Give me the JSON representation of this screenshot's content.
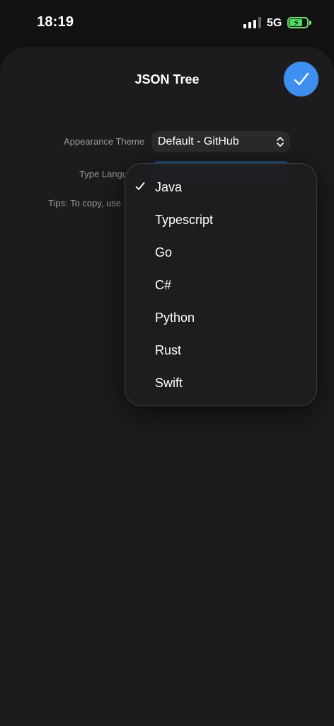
{
  "status_bar": {
    "time": "18:19",
    "network": "5G",
    "icons": [
      "signal-icon",
      "battery-charging-icon"
    ],
    "battery_color": "#4cd964"
  },
  "sheet": {
    "title": "JSON Tree",
    "done_icon": "checkmark-icon",
    "accent_color": "#3d8ff0"
  },
  "settings": {
    "appearance_label": "Appearance Theme",
    "appearance_value": "Default - GitHub",
    "type_language_label": "Type Langu",
    "tips_text": "Tips: To copy, use"
  },
  "menu": {
    "items": [
      {
        "label": "Java",
        "selected": true
      },
      {
        "label": "Typescript",
        "selected": false
      },
      {
        "label": "Go",
        "selected": false
      },
      {
        "label": "C#",
        "selected": false
      },
      {
        "label": "Python",
        "selected": false
      },
      {
        "label": "Rust",
        "selected": false
      },
      {
        "label": "Swift",
        "selected": false
      }
    ]
  }
}
